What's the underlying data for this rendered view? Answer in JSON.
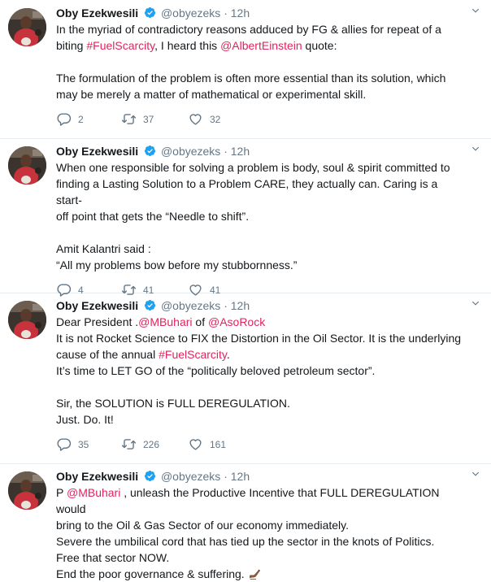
{
  "author": {
    "name": "Oby Ezekwesili",
    "handle": "@obyezeks",
    "separator": "·"
  },
  "icons": {
    "verified": "verified-badge-icon",
    "caret": "chevron-down-icon",
    "reply": "reply-icon",
    "retweet": "retweet-icon",
    "like": "heart-icon",
    "writing": "writing-hand-emoji-icon"
  },
  "colors": {
    "link": "#e0245e",
    "verified": "#1da1f2",
    "muted": "#657786"
  },
  "tweets": [
    {
      "time": "12h",
      "lines": [
        {
          "a": "In the myriad of contradictory reasons adduced by FG & allies for repeat of a"
        },
        {
          "a": "biting ",
          "l1": "#FuelScarcity",
          "b": ", I heard this ",
          "l2": "@AlbertEinstein",
          "c": " quote:"
        },
        {
          "a": ""
        },
        {
          "a": "The formulation of the problem is often more essential than its solution, which"
        },
        {
          "a": "may be merely a matter of mathematical or experimental skill."
        }
      ],
      "replies": "2",
      "retweets": "37",
      "likes": "32"
    },
    {
      "time": "12h",
      "lines": [
        {
          "a": "When one responsible for solving a problem is body, soul & spirit committed to"
        },
        {
          "a": "finding a Lasting Solution to a Problem CARE, they actually can. Caring is a start-"
        },
        {
          "a": "off point that gets the “Needle to shift”."
        },
        {
          "a": ""
        },
        {
          "a": "Amit Kalantri said :"
        },
        {
          "a": "“All my problems bow before my stubbornness.”"
        }
      ],
      "replies": "4",
      "retweets": "41",
      "likes": "41"
    },
    {
      "time": "12h",
      "lines": [
        {
          "a": "Dear President .",
          "l1": "@MBuhari",
          "b": " of ",
          "l2": "@AsoRock",
          "c": ""
        },
        {
          "a": "It is not Rocket Science to FIX the Distortion in the Oil Sector. It is the underlying"
        },
        {
          "a": "cause of the annual ",
          "l1": "#FuelScarcity",
          "b": "."
        },
        {
          "a": "It’s time to LET GO of the “politically beloved petroleum sector”."
        },
        {
          "a": ""
        },
        {
          "a": "Sir, the SOLUTION is FULL DEREGULATION."
        },
        {
          "a": "Just. Do. It!"
        }
      ],
      "replies": "35",
      "retweets": "226",
      "likes": "161"
    },
    {
      "time": "12h",
      "lines": [
        {
          "a": "P ",
          "l1": "@MBuhari",
          "b": " , unleash the Productive Incentive that FULL DEREGULATION would"
        },
        {
          "a": "bring to the Oil & Gas Sector of our economy immediately."
        },
        {
          "a": "Severe the umbilical cord that has tied up the sector in the knots of Politics."
        },
        {
          "a": "Free that sector NOW."
        },
        {
          "a": "End the poor governance & suffering."
        }
      ]
    }
  ]
}
